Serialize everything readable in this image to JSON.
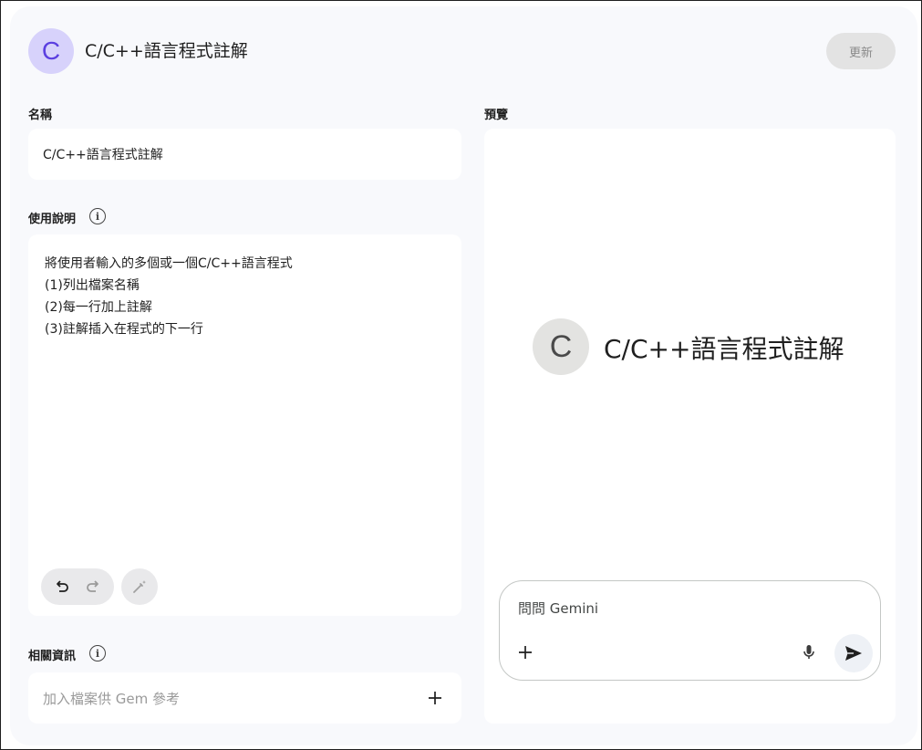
{
  "header": {
    "avatar_letter": "C",
    "title": "C/C++語言程式註解",
    "update_label": "更新"
  },
  "name_section": {
    "label": "名稱",
    "value": "C/C++語言程式註解"
  },
  "instructions_section": {
    "label": "使用說明",
    "info_icon": "info-icon",
    "lines": [
      "將使用者輸入的多個或一個C/C++語言程式",
      "(1)列出檔案名稱",
      "(2)每一行加上註解",
      "(3)註解插入在程式的下一行"
    ]
  },
  "knowledge_section": {
    "label": "相關資訊",
    "info_icon": "info-icon",
    "placeholder": "加入檔案供 Gem 參考"
  },
  "preview": {
    "label": "預覽",
    "avatar_letter": "C",
    "title": "C/C++語言程式註解",
    "chat_placeholder": "問問 Gemini"
  },
  "colors": {
    "accent_avatar_bg": "#d7d2fb",
    "accent_avatar_fg": "#5b3fe0",
    "panel_bg": "#f8f9fc",
    "disabled_button_bg": "#e3e3e3"
  }
}
